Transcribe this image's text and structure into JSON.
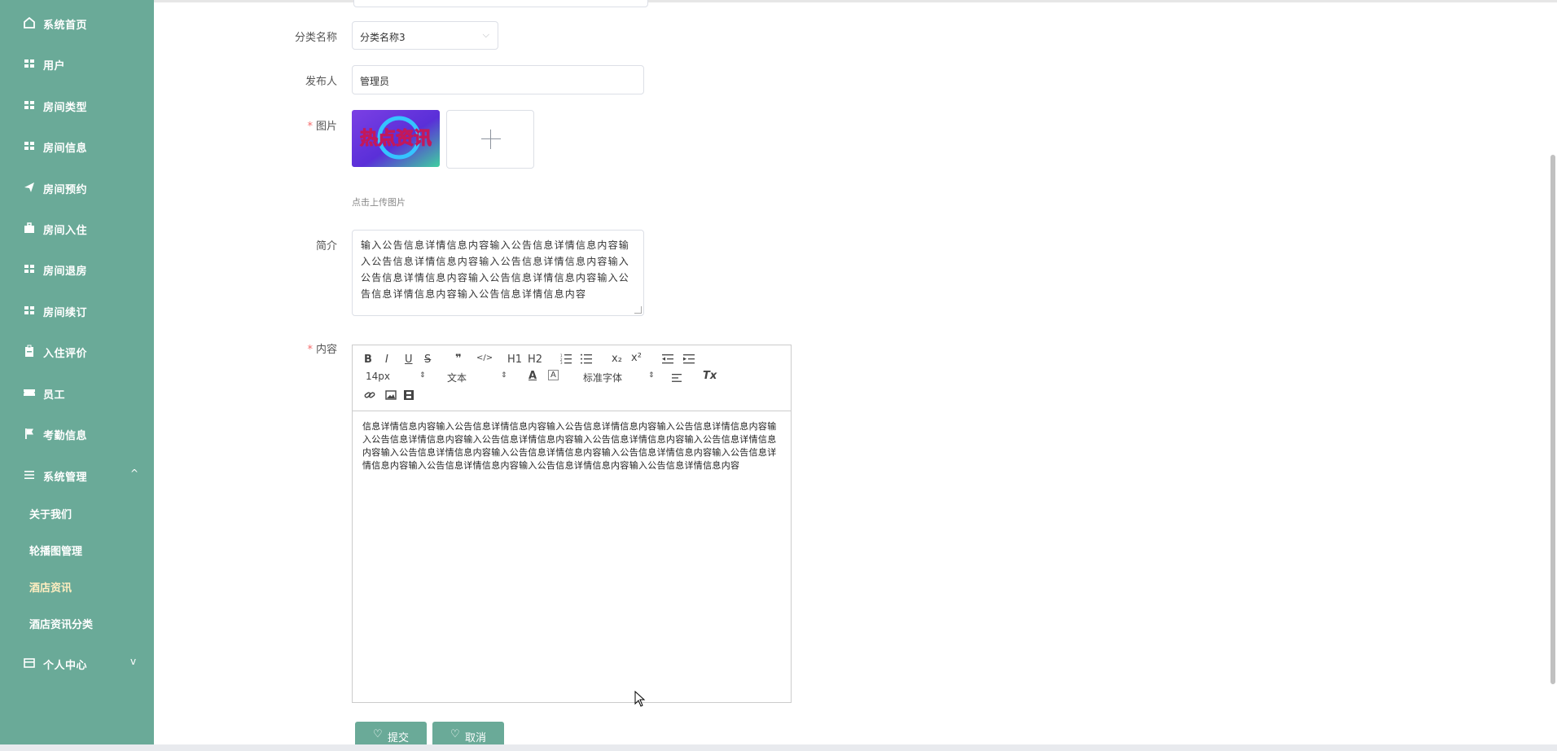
{
  "sidebar": {
    "items": [
      {
        "label": "系统首页",
        "icon": "home-icon"
      },
      {
        "label": "用户",
        "icon": "grid-icon"
      },
      {
        "label": "房间类型",
        "icon": "grid-icon"
      },
      {
        "label": "房间信息",
        "icon": "grid-icon"
      },
      {
        "label": "房间预约",
        "icon": "send-icon"
      },
      {
        "label": "房间入住",
        "icon": "briefcase-icon"
      },
      {
        "label": "房间退房",
        "icon": "grid-icon"
      },
      {
        "label": "房间续订",
        "icon": "grid-icon"
      },
      {
        "label": "入住评价",
        "icon": "clipboard-icon"
      },
      {
        "label": "员工",
        "icon": "ticket-icon"
      },
      {
        "label": "考勤信息",
        "icon": "flag-icon"
      },
      {
        "label": "系统管理",
        "icon": "menu-icon",
        "arrow": "^"
      },
      {
        "label": "个人中心",
        "icon": "card-icon",
        "arrow": "v"
      }
    ],
    "subitems": [
      {
        "label": "关于我们"
      },
      {
        "label": "轮播图管理"
      },
      {
        "label": "酒店资讯",
        "active": true
      },
      {
        "label": "酒店资讯分类"
      }
    ]
  },
  "form": {
    "category_label": "分类名称",
    "category_value": "分类名称3",
    "publisher_label": "发布人",
    "publisher_value": "管理员",
    "image_label": "图片",
    "image_overlay_text": "热点资讯",
    "upload_tip": "点击上传图片",
    "summary_label": "简介",
    "summary_value": "输入公告信息详情信息内容输入公告信息详情信息内容输入公告信息详情信息内容输入公告信息详情信息内容输入公告信息详情信息内容输入公告信息详情信息内容输入公告信息详情信息内容输入公告信息详情信息内容",
    "content_label": "内容",
    "required_mark": "*"
  },
  "editor": {
    "toolbar": {
      "bold": "B",
      "italic": "I",
      "underline": "U",
      "strike": "S",
      "quote": "❞",
      "code": "</>",
      "h1": "H1",
      "h2": "H2",
      "subscript": "x₂",
      "superscript": "x²",
      "size": "14px",
      "header": "文本",
      "font": "标准字体"
    },
    "content": "信息详情信息内容输入公告信息详情信息内容输入公告信息详情信息内容输入公告信息详情信息内容输入公告信息详情信息内容输入公告信息详情信息内容输入公告信息详情信息内容输入公告信息详情信息内容输入公告信息详情信息内容输入公告信息详情信息内容输入公告信息详情信息内容输入公告信息详情信息内容输入公告信息详情信息内容输入公告信息详情信息内容输入公告信息详情信息内容"
  },
  "buttons": {
    "submit": "提交",
    "cancel": "取消",
    "icon": "heart-icon"
  },
  "colors": {
    "sidebar_bg": "#6aaa98",
    "active_text": "#ffeec0",
    "required": "#f56c6c"
  }
}
